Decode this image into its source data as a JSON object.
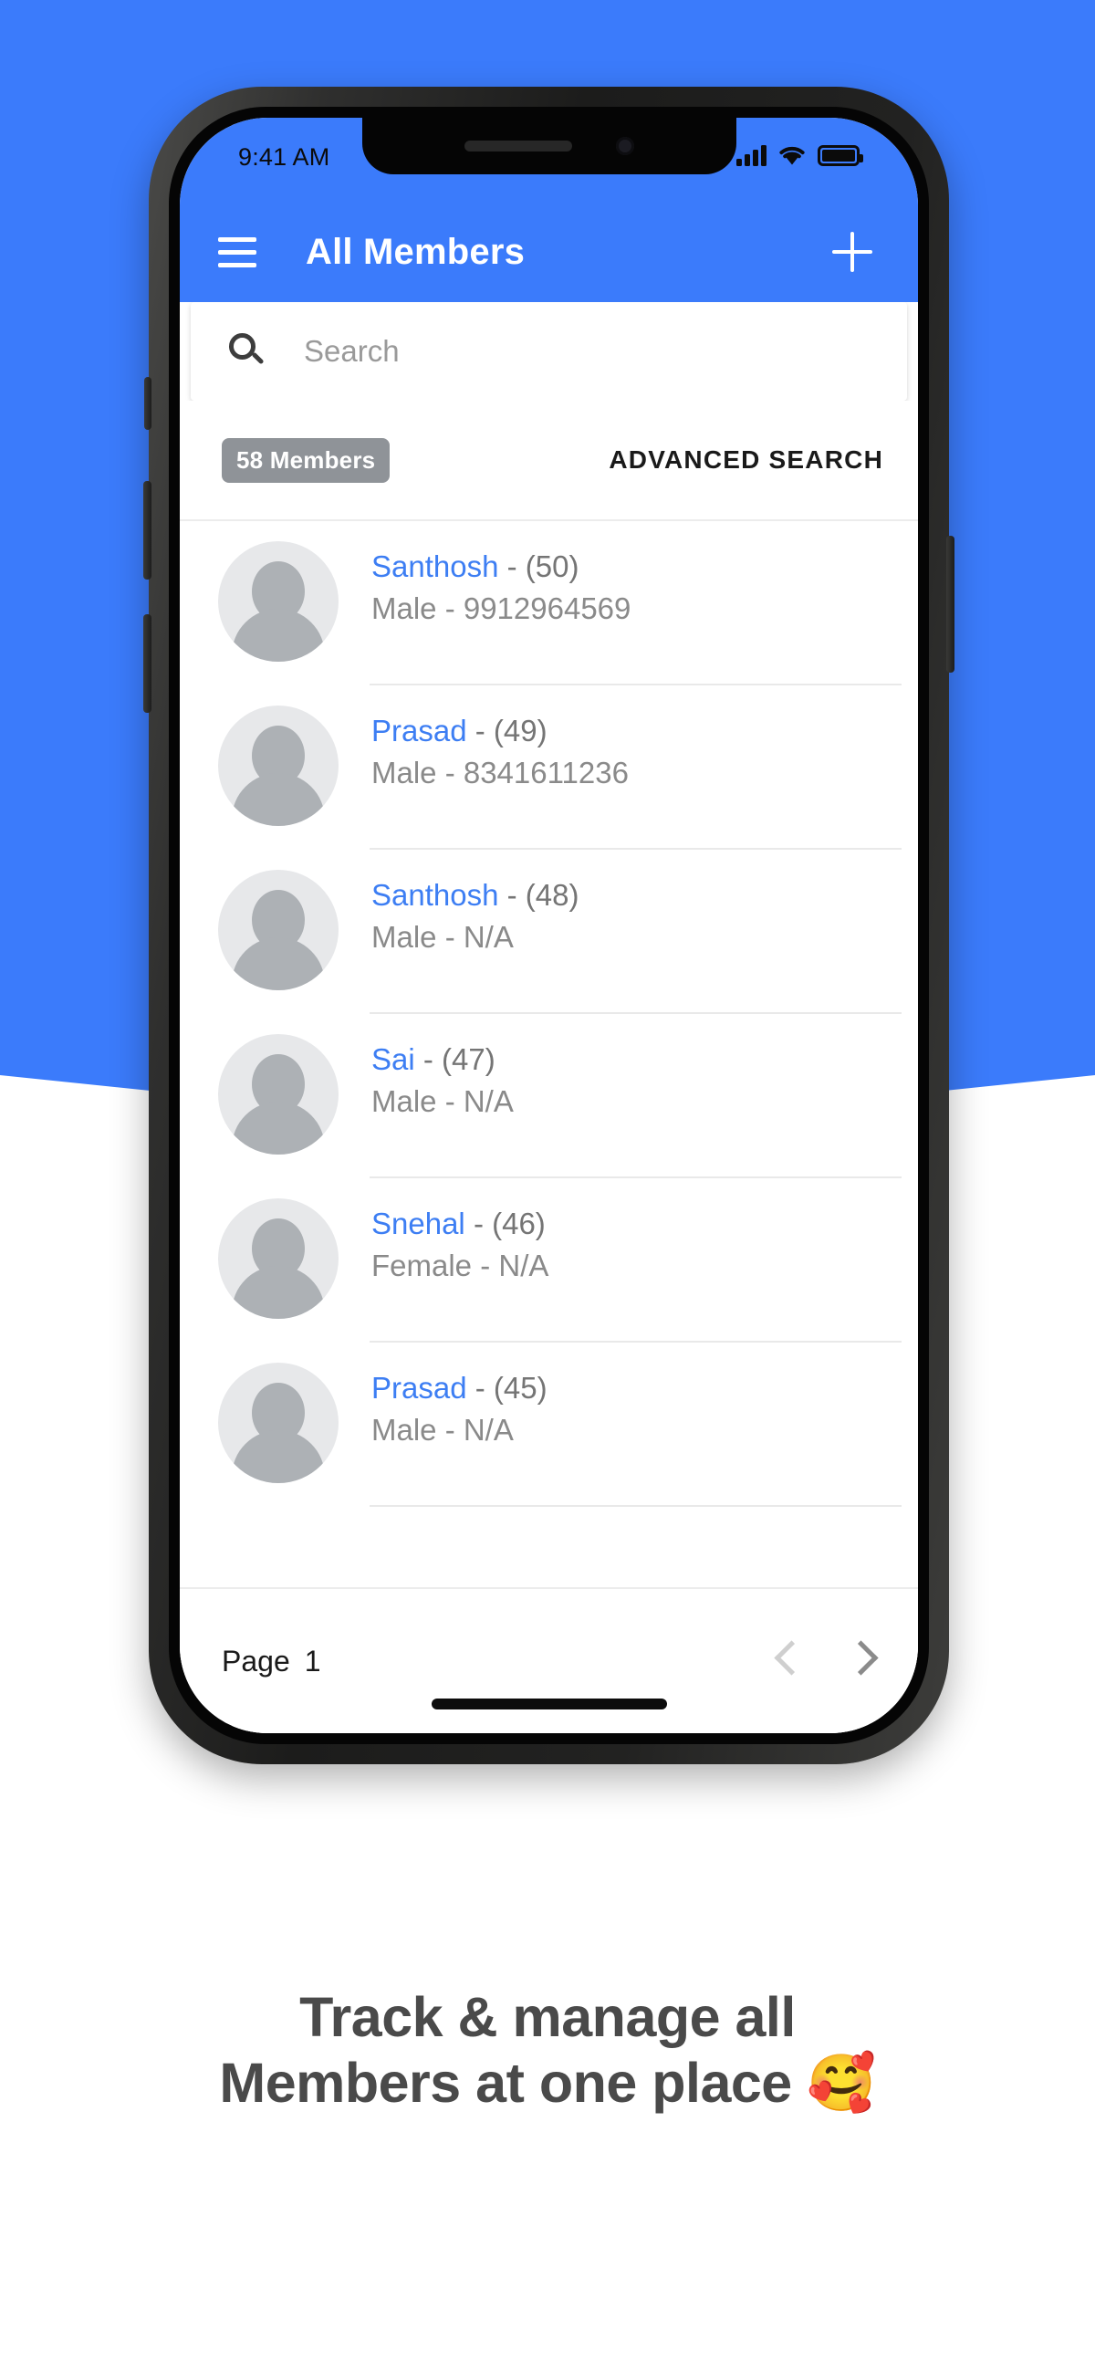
{
  "theme": {
    "accent": "#3b7bfb",
    "link_blue": "#3d7ef3",
    "badge_gray": "#8f9398",
    "caption_gray": "#4a4a4a"
  },
  "status_bar": {
    "time": "9:41 AM",
    "icons": {
      "signal": "signal-bars-icon",
      "wifi": "wifi-icon",
      "battery": "battery-full-icon"
    }
  },
  "app_bar": {
    "menu_icon": "hamburger-menu-icon",
    "title": "All Members",
    "add_icon": "plus-icon"
  },
  "search": {
    "icon": "search-icon",
    "placeholder": "Search",
    "value": ""
  },
  "toolbar": {
    "member_count_badge": "58 Members",
    "advanced_search_label": "ADVANCED SEARCH"
  },
  "members": [
    {
      "name": "Santhosh",
      "separator": "-",
      "age": "(50)",
      "details": "Male - 9912964569"
    },
    {
      "name": "Prasad",
      "separator": "-",
      "age": "(49)",
      "details": "Male - 8341611236"
    },
    {
      "name": "Santhosh",
      "separator": "-",
      "age": "(48)",
      "details": "Male - N/A"
    },
    {
      "name": "Sai",
      "separator": "-",
      "age": "(47)",
      "details": "Male - N/A"
    },
    {
      "name": "Snehal",
      "separator": "-",
      "age": "(46)",
      "details": "Female - N/A"
    },
    {
      "name": "Prasad",
      "separator": "-",
      "age": "(45)",
      "details": "Male - N/A"
    }
  ],
  "pagination": {
    "label": "Page",
    "current_page": "1",
    "prev_icon": "chevron-left-icon",
    "next_icon": "chevron-right-icon"
  },
  "caption": {
    "line1": "Track & manage all",
    "line2": "Members at one place 🥰"
  }
}
